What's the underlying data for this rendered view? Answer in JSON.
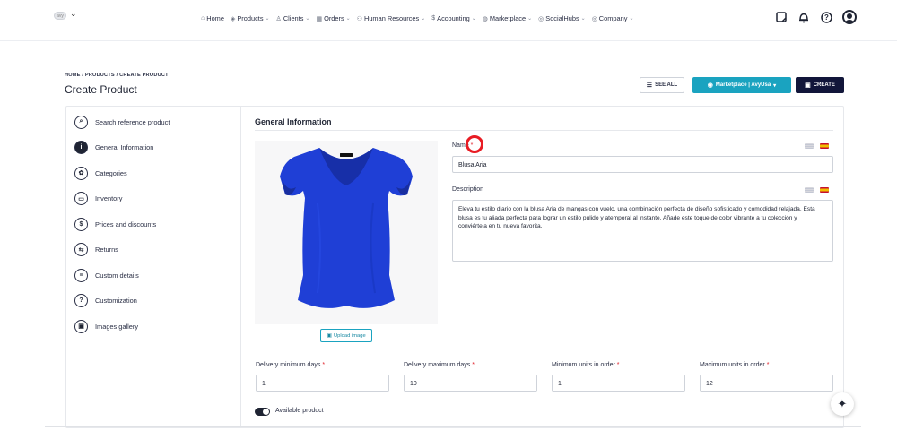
{
  "nav": {
    "items": [
      {
        "label": "Home",
        "icon": "home-icon",
        "has_chevron": false
      },
      {
        "label": "Products",
        "icon": "box-icon",
        "has_chevron": true
      },
      {
        "label": "Clients",
        "icon": "users-icon",
        "has_chevron": true
      },
      {
        "label": "Orders",
        "icon": "calendar-icon",
        "has_chevron": true
      },
      {
        "label": "Human Resources",
        "icon": "people-icon",
        "has_chevron": true
      },
      {
        "label": "Accounting",
        "icon": "dollar-icon",
        "has_chevron": true
      },
      {
        "label": "Marketplace",
        "icon": "store-icon",
        "has_chevron": true
      },
      {
        "label": "SocialHubs",
        "icon": "share-icon",
        "has_chevron": true
      },
      {
        "label": "Company",
        "icon": "building-icon",
        "has_chevron": true
      }
    ]
  },
  "header": {
    "breadcrumb": "HOME / PRODUCTS / CREATE PRODUCT",
    "title": "Create Product",
    "see_all": "SEE ALL",
    "marketplace": "Marketplace | AvyUsa",
    "create": "CREATE"
  },
  "sidebar": {
    "items": [
      {
        "label": "Search reference product",
        "icon": "search-icon",
        "glyph": "⌕",
        "active": false
      },
      {
        "label": "General Information",
        "icon": "info-icon",
        "glyph": "i",
        "active": true
      },
      {
        "label": "Categories",
        "icon": "gear-icon",
        "glyph": "✿",
        "active": false
      },
      {
        "label": "Inventory",
        "icon": "inventory-icon",
        "glyph": "▭",
        "active": false
      },
      {
        "label": "Prices and discounts",
        "icon": "dollar-icon",
        "glyph": "$",
        "active": false
      },
      {
        "label": "Returns",
        "icon": "returns-icon",
        "glyph": "⇆",
        "active": false
      },
      {
        "label": "Custom details",
        "icon": "list-icon",
        "glyph": "≡",
        "active": false
      },
      {
        "label": "Customization",
        "icon": "question-icon",
        "glyph": "?",
        "active": false
      },
      {
        "label": "Images gallery",
        "icon": "gallery-icon",
        "glyph": "▣",
        "active": false
      }
    ]
  },
  "form": {
    "section_title": "General Information",
    "upload_label": "Upload image",
    "name_label": "Name",
    "name_value": "Blusa Aria",
    "description_label": "Description",
    "description_value": "Eleva tu estilo diario con la blusa Aria de mangas con vuelo, una combinación perfecta de diseño sofisticado y comodidad relajada. Esta  blusa es tu aliada perfecta para lograr un estilo pulido y atemporal al instante. Añade este toque de color vibrante a tu colección y conviértela en tu nueva favorita.",
    "delivery_min_label": "Delivery minimum days",
    "delivery_min_value": "1",
    "delivery_max_label": "Delivery maximum days",
    "delivery_max_value": "10",
    "min_units_label": "Minimum units in order",
    "min_units_value": "1",
    "max_units_label": "Maximum units in order",
    "max_units_value": "12",
    "required_mark": "*",
    "available_label": "Available product",
    "available_on": true
  },
  "colors": {
    "primary_dark": "#12163a",
    "accent_teal": "#1aa3c0",
    "required_red": "#e0202a",
    "product_blue": "#1f3fd6"
  }
}
